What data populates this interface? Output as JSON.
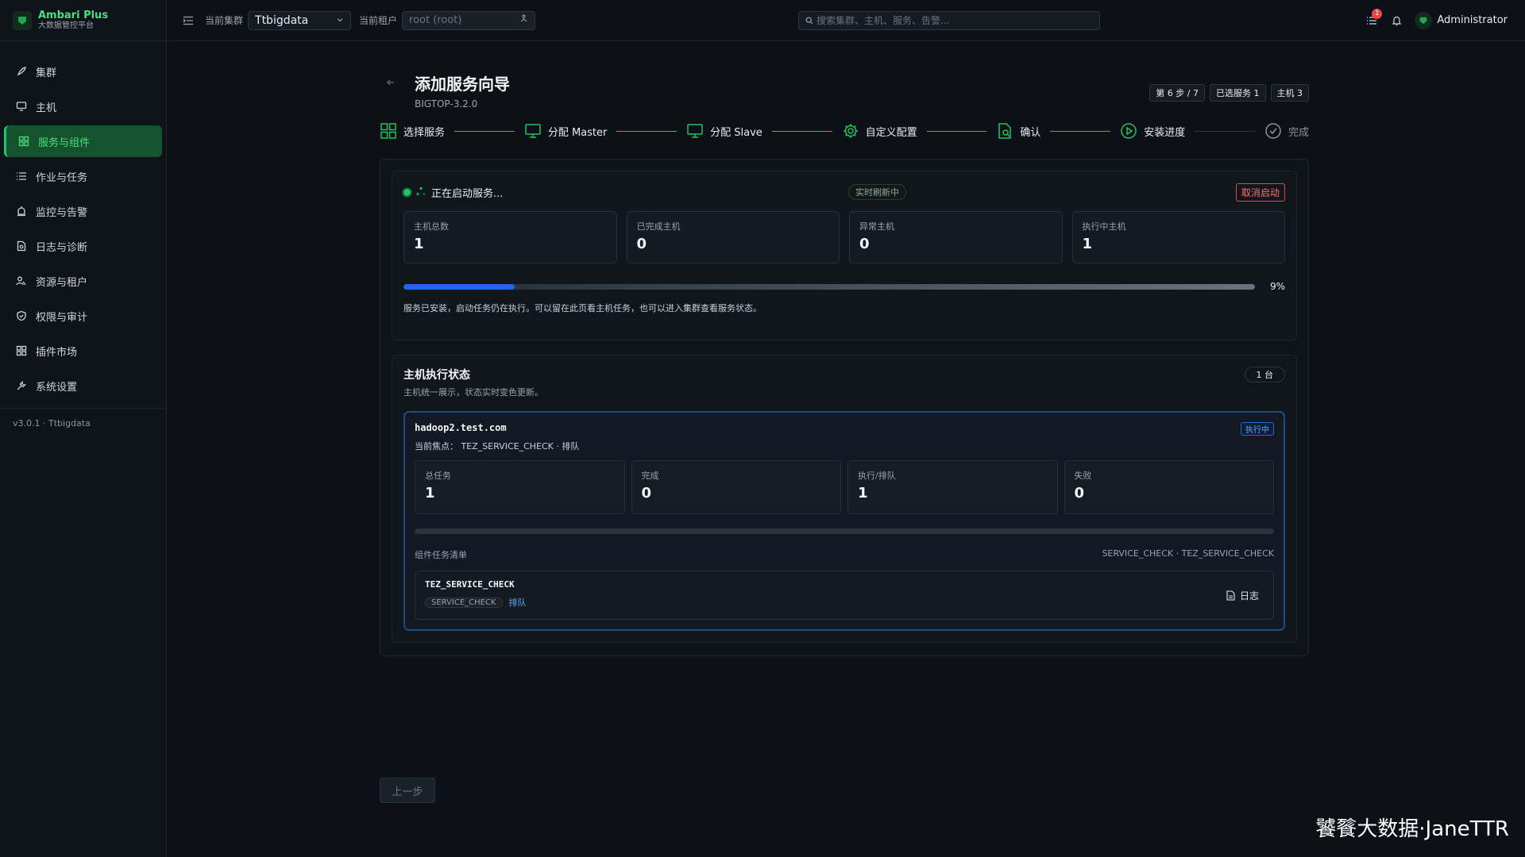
{
  "brand": {
    "title": "Ambari Plus",
    "subtitle": "大数据管控平台"
  },
  "sidebar": {
    "items": [
      {
        "label": "集群",
        "icon": "rocket-icon"
      },
      {
        "label": "主机",
        "icon": "monitor-icon"
      },
      {
        "label": "服务与组件",
        "icon": "grid-icon",
        "active": true
      },
      {
        "label": "作业与任务",
        "icon": "list-icon"
      },
      {
        "label": "监控与告警",
        "icon": "alarm-icon"
      },
      {
        "label": "日志与诊断",
        "icon": "file-search-icon"
      },
      {
        "label": "资源与租户",
        "icon": "users-icon"
      },
      {
        "label": "权限与审计",
        "icon": "shield-icon"
      },
      {
        "label": "插件市场",
        "icon": "apps-icon"
      },
      {
        "label": "系统设置",
        "icon": "wrench-icon"
      }
    ],
    "version": "v3.0.1 · Ttbigdata"
  },
  "topbar": {
    "cluster_label": "当前集群",
    "cluster_value": "Ttbigdata",
    "tenant_label": "当前租户",
    "tenant_placeholder": "root (root)",
    "search_placeholder": "搜索集群、主机、服务、告警...",
    "notification_count": "1",
    "user": "Administrator"
  },
  "wizard": {
    "title": "添加服务向导",
    "subtitle": "BIGTOP-3.2.0",
    "chips": [
      "第 6 步 / 7",
      "已选服务 1",
      "主机 3"
    ],
    "steps": [
      {
        "label": "选择服务",
        "icon": "grid-icon"
      },
      {
        "label": "分配 Master",
        "icon": "monitor-icon"
      },
      {
        "label": "分配 Slave",
        "icon": "monitor-icon"
      },
      {
        "label": "自定义配置",
        "icon": "gear-icon"
      },
      {
        "label": "确认",
        "icon": "file-search-icon"
      },
      {
        "label": "安装进度",
        "icon": "play-circle-icon"
      },
      {
        "label": "完成",
        "icon": "check-circle-icon"
      }
    ]
  },
  "progress": {
    "status": "正在启动服务...",
    "live": "实时刷新中",
    "cancel": "取消启动",
    "stats": [
      {
        "label": "主机总数",
        "value": "1"
      },
      {
        "label": "已完成主机",
        "value": "0"
      },
      {
        "label": "异常主机",
        "value": "0"
      },
      {
        "label": "执行中主机",
        "value": "1"
      }
    ],
    "percent": 9,
    "percent_text": "9%",
    "note": "服务已安装，启动任务仍在执行。可以留在此页看主机任务，也可以进入集群查看服务状态。"
  },
  "hosts_section": {
    "title": "主机执行状态",
    "subtitle": "主机统一展示，状态实时变色更新。",
    "count": "1 台",
    "host": {
      "name": "hadoop2.test.com",
      "status": "执行中",
      "focus": "当前焦点： TEZ_SERVICE_CHECK · 排队",
      "stats": [
        {
          "label": "总任务",
          "value": "1"
        },
        {
          "label": "完成",
          "value": "0"
        },
        {
          "label": "执行/排队",
          "value": "1"
        },
        {
          "label": "失败",
          "value": "0"
        }
      ],
      "list_title": "组件任务清单",
      "list_filter": "SERVICE_CHECK · TEZ_SERVICE_CHECK",
      "task": {
        "name": "TEZ_SERVICE_CHECK",
        "tag": "SERVICE_CHECK",
        "state": "排队",
        "log": "日志"
      }
    }
  },
  "footer": {
    "prev": "上一步",
    "watermark": "饕餮大数据·JaneTTR"
  },
  "colors": {
    "accent": "#22c55e",
    "progress": "#2563eb",
    "danger": "#ef4444",
    "running": "#60a5fa"
  }
}
